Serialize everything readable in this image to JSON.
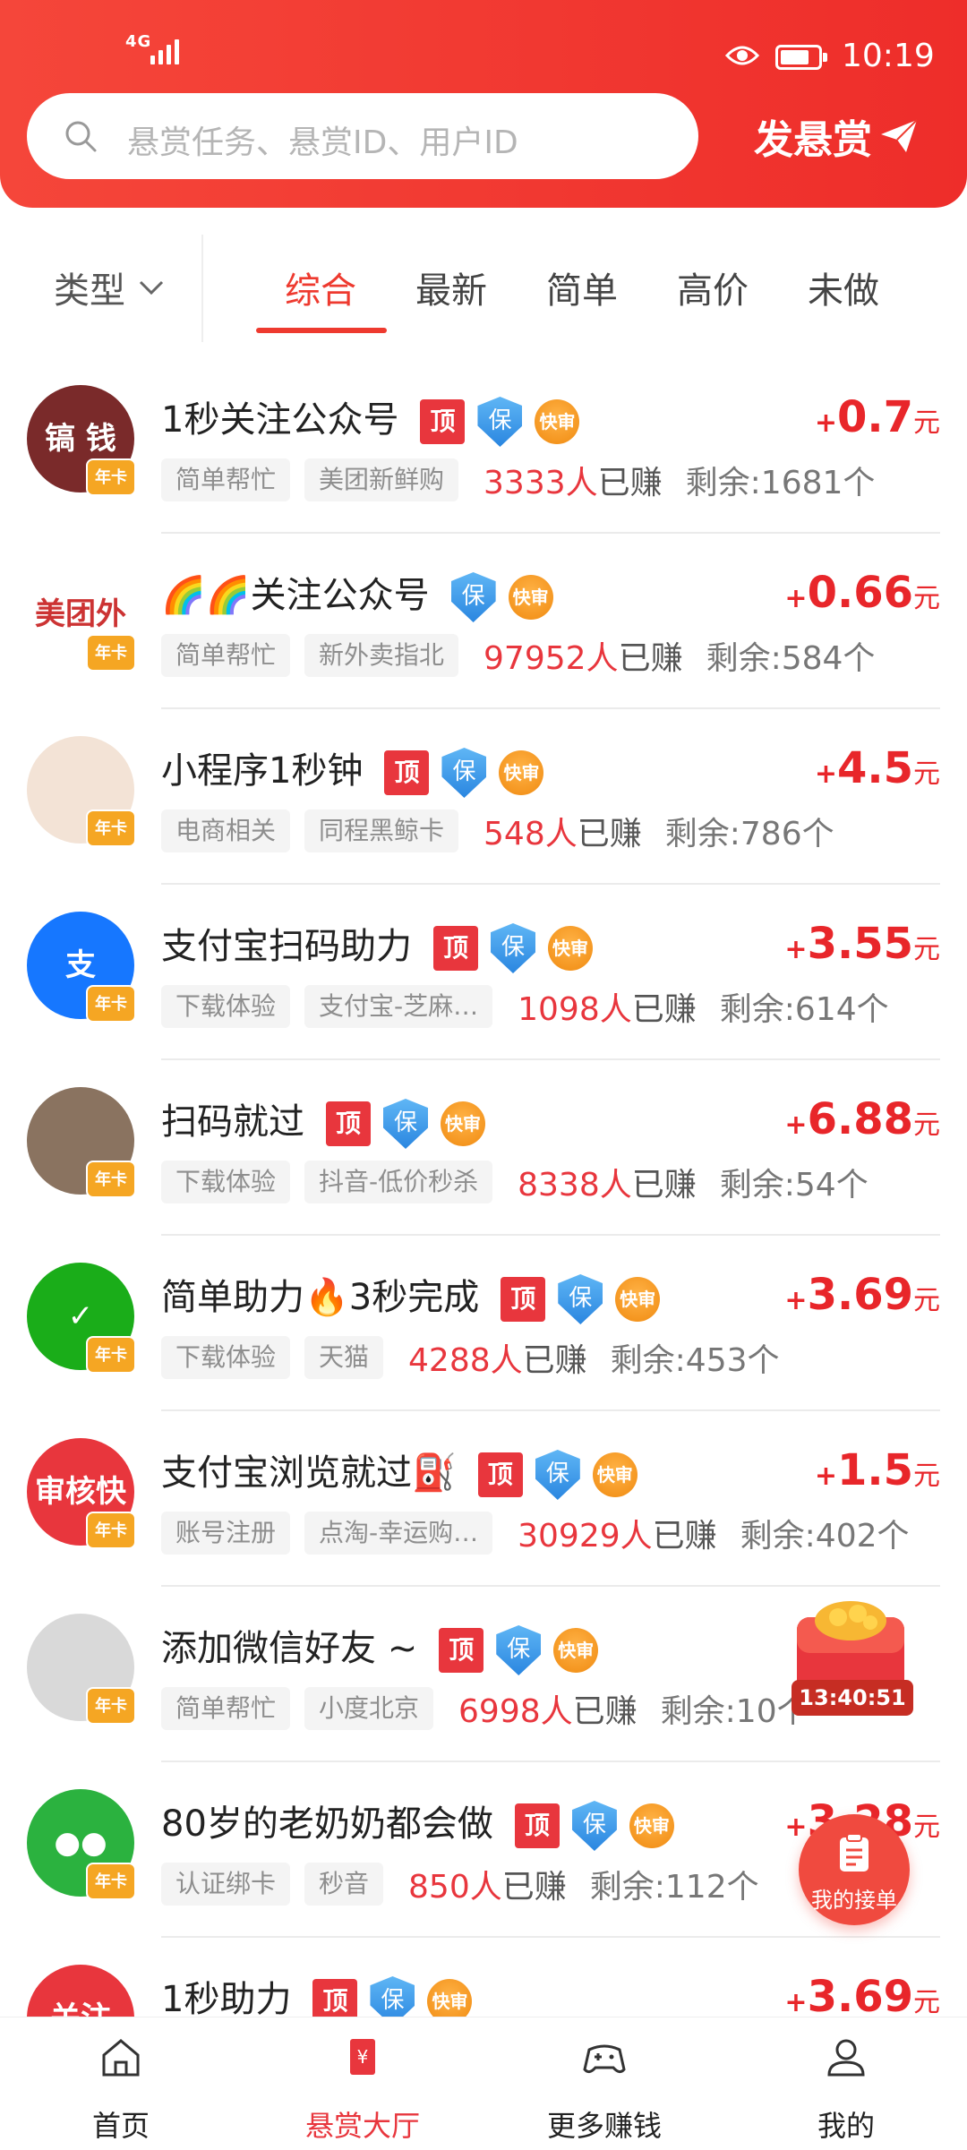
{
  "status": {
    "network": "4G",
    "time": "10:19"
  },
  "search": {
    "placeholder": "悬赏任务、悬赏ID、用户ID",
    "post_label": "发悬赏"
  },
  "filter": {
    "type_label": "类型",
    "tabs": [
      "综合",
      "最新",
      "简单",
      "高价",
      "未做"
    ],
    "active_tab": "综合"
  },
  "list": [
    {
      "title": "1秒关注公众号",
      "ding": true,
      "badge_ding": "顶",
      "badge_bao": "保",
      "badge_kuai": "快审",
      "tags": [
        "简单帮忙",
        "美团新鲜购"
      ],
      "earned_count": "3333人",
      "earned_suffix": "已赚",
      "remaining": "剩余:1681个",
      "price_plus": "+",
      "price": "0.7",
      "unit": "元",
      "avatar_color": "#7a2a2a",
      "avatar_text": "镐 钱",
      "year_card": "年卡"
    },
    {
      "title": "🌈🌈关注公众号",
      "ding": false,
      "badge_ding": "顶",
      "badge_bao": "保",
      "badge_kuai": "快审",
      "tags": [
        "简单帮忙",
        "新外卖指北"
      ],
      "earned_count": "97952人",
      "earned_suffix": "已赚",
      "remaining": "剩余:584个",
      "price_plus": "+",
      "price": "0.66",
      "unit": "元",
      "avatar_color": "#ffffff",
      "avatar_text": "美团外卖",
      "year_card": "年卡"
    },
    {
      "title": "小程序1秒钟",
      "ding": true,
      "badge_ding": "顶",
      "badge_bao": "保",
      "badge_kuai": "快审",
      "tags": [
        "电商相关",
        "同程黑鲸卡"
      ],
      "earned_count": "548人",
      "earned_suffix": "已赚",
      "remaining": "剩余:786个",
      "price_plus": "+",
      "price": "4.5",
      "unit": "元",
      "avatar_color": "#f3e3d6",
      "avatar_text": "",
      "year_card": "年卡"
    },
    {
      "title": "支付宝扫码助力",
      "ding": true,
      "badge_ding": "顶",
      "badge_bao": "保",
      "badge_kuai": "快审",
      "tags": [
        "下载体验",
        "支付宝-芝麻…"
      ],
      "earned_count": "1098人",
      "earned_suffix": "已赚",
      "remaining": "剩余:614个",
      "price_plus": "+",
      "price": "3.55",
      "unit": "元",
      "avatar_color": "#1677ff",
      "avatar_text": "支",
      "year_card": "年卡"
    },
    {
      "title": "扫码就过",
      "ding": true,
      "badge_ding": "顶",
      "badge_bao": "保",
      "badge_kuai": "快审",
      "tags": [
        "下载体验",
        "抖音-低价秒杀"
      ],
      "earned_count": "8338人",
      "earned_suffix": "已赚",
      "remaining": "剩余:54个",
      "price_plus": "+",
      "price": "6.88",
      "unit": "元",
      "avatar_color": "#8a7360",
      "avatar_text": "",
      "year_card": "年卡"
    },
    {
      "title": "简单助力🔥3秒完成",
      "ding": true,
      "badge_ding": "顶",
      "badge_bao": "保",
      "badge_kuai": "快审",
      "tags": [
        "下载体验",
        "天猫"
      ],
      "earned_count": "4288人",
      "earned_suffix": "已赚",
      "remaining": "剩余:453个",
      "price_plus": "+",
      "price": "3.69",
      "unit": "元",
      "avatar_color": "#1aad19",
      "avatar_text": "✓",
      "year_card": "年卡"
    },
    {
      "title": "支付宝浏览就过⛽",
      "ding": true,
      "badge_ding": "顶",
      "badge_bao": "保",
      "badge_kuai": "快审",
      "tags": [
        "账号注册",
        "点淘-幸运购…"
      ],
      "earned_count": "30929人",
      "earned_suffix": "已赚",
      "remaining": "剩余:402个",
      "price_plus": "+",
      "price": "1.5",
      "unit": "元",
      "avatar_color": "#e8363d",
      "avatar_text": "审核快",
      "year_card": "年卡"
    },
    {
      "title": "添加微信好友 ~",
      "ding": true,
      "badge_ding": "顶",
      "badge_bao": "保",
      "badge_kuai": "快审",
      "tags": [
        "简单帮忙",
        "小度北京"
      ],
      "earned_count": "6998人",
      "earned_suffix": "已赚",
      "remaining": "剩余:10个",
      "price_plus": "",
      "price": "",
      "unit": "元",
      "avatar_color": "#d9d9d9",
      "avatar_text": "",
      "year_card": "年卡"
    },
    {
      "title": "80岁的老奶奶都会做",
      "ding": true,
      "badge_ding": "顶",
      "badge_bao": "保",
      "badge_kuai": "快审",
      "tags": [
        "认证绑卡",
        "秒音"
      ],
      "earned_count": "850人",
      "earned_suffix": "已赚",
      "remaining": "剩余:112个",
      "price_plus": "+",
      "price": "3.28",
      "unit": "元",
      "avatar_color": "#2bb23f",
      "avatar_text": "●●",
      "year_card": "年卡"
    },
    {
      "title": "1秒助力",
      "ding": true,
      "badge_ding": "顶",
      "badge_bao": "保",
      "badge_kuai": "快审",
      "tags": [],
      "earned_count": "",
      "earned_suffix": "",
      "remaining": "",
      "price_plus": "+",
      "price": "3.69",
      "unit": "元",
      "avatar_color": "#e8363d",
      "avatar_text": "关注",
      "year_card": ""
    }
  ],
  "floating": {
    "timer": "13:40:51",
    "my_orders": "我的接单"
  },
  "tabbar": [
    {
      "label": "首页",
      "icon": "home-icon"
    },
    {
      "label": "悬赏大厅",
      "icon": "reward-hall-icon"
    },
    {
      "label": "更多赚钱",
      "icon": "gamepad-icon"
    },
    {
      "label": "我的",
      "icon": "profile-icon"
    }
  ],
  "colors": {
    "brand": "#ee3a2f",
    "price": "#e8262a"
  }
}
